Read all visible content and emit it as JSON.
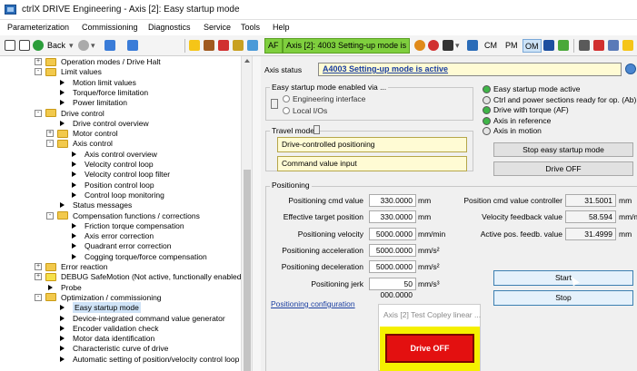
{
  "window": {
    "title": "ctrlX DRIVE Engineering - Axis [2]: Easy startup mode"
  },
  "menu": [
    "Parameterization",
    "Commissioning",
    "Diagnostics",
    "Service",
    "Tools",
    "Help"
  ],
  "toolbar": {
    "back_label": "Back",
    "af_label": "AF",
    "axis_status_text": "Axis [2]:  4003 Setting-up mode is a",
    "cm": "CM",
    "pm": "PM",
    "om": "OM"
  },
  "tree": [
    {
      "label": "Operation modes / Drive Halt",
      "depth": 1,
      "kind": "folder",
      "exp": "+"
    },
    {
      "label": "Limit values",
      "depth": 1,
      "kind": "folder",
      "exp": "-"
    },
    {
      "label": "Motion limit values",
      "depth": 2,
      "kind": "leaf"
    },
    {
      "label": "Torque/force limitation",
      "depth": 2,
      "kind": "leaf"
    },
    {
      "label": "Power limitation",
      "depth": 2,
      "kind": "leaf"
    },
    {
      "label": "Drive control",
      "depth": 1,
      "kind": "folder",
      "exp": "-"
    },
    {
      "label": "Drive control overview",
      "depth": 2,
      "kind": "leaf"
    },
    {
      "label": "Motor control",
      "depth": 2,
      "kind": "folder",
      "exp": "+"
    },
    {
      "label": "Axis control",
      "depth": 2,
      "kind": "folder",
      "exp": "-"
    },
    {
      "label": "Axis control overview",
      "depth": 3,
      "kind": "leaf"
    },
    {
      "label": "Velocity control loop",
      "depth": 3,
      "kind": "leaf"
    },
    {
      "label": "Velocity control loop filter",
      "depth": 3,
      "kind": "leaf"
    },
    {
      "label": "Position control loop",
      "depth": 3,
      "kind": "leaf"
    },
    {
      "label": "Control loop monitoring",
      "depth": 3,
      "kind": "leaf"
    },
    {
      "label": "Status messages",
      "depth": 2,
      "kind": "leaf"
    },
    {
      "label": "Compensation functions / corrections",
      "depth": 2,
      "kind": "folder",
      "exp": "-"
    },
    {
      "label": "Friction torque compensation",
      "depth": 3,
      "kind": "leaf"
    },
    {
      "label": "Axis error correction",
      "depth": 3,
      "kind": "leaf"
    },
    {
      "label": "Quadrant error correction",
      "depth": 3,
      "kind": "leaf"
    },
    {
      "label": "Cogging torque/force compensation",
      "depth": 3,
      "kind": "leaf"
    },
    {
      "label": "Error reaction",
      "depth": 1,
      "kind": "folder",
      "exp": "+"
    },
    {
      "label": "DEBUG SafeMotion (Not active, functionally enabled): def",
      "depth": 1,
      "kind": "safe",
      "exp": "+"
    },
    {
      "label": "Probe",
      "depth": 1,
      "kind": "leaf"
    },
    {
      "label": "Optimization / commissioning",
      "depth": 1,
      "kind": "folder",
      "exp": "-"
    },
    {
      "label": "Easy startup mode",
      "depth": 2,
      "kind": "leaf",
      "selected": true
    },
    {
      "label": "Device-integrated command value generator",
      "depth": 2,
      "kind": "leaf"
    },
    {
      "label": "Encoder validation check",
      "depth": 2,
      "kind": "leaf"
    },
    {
      "label": "Motor data identification",
      "depth": 2,
      "kind": "leaf"
    },
    {
      "label": "Characteristic curve of drive",
      "depth": 2,
      "kind": "leaf"
    },
    {
      "label": "Automatic setting of position/velocity control loop",
      "depth": 2,
      "kind": "leaf"
    }
  ],
  "main": {
    "axis_status_label": "Axis status",
    "axis_status_value": "A4003 Setting-up mode is active",
    "easy_group_title": "Easy startup mode enabled via ...",
    "radio_engineering": "Engineering interface",
    "radio_local": "Local I/Os",
    "travel_mode_title": "Travel mode",
    "travel_mode_value": "Drive-controlled positioning",
    "travel_input_value": "Command value input",
    "status_leds": [
      {
        "label": "Easy startup mode active",
        "color": "#3fb548"
      },
      {
        "label": "Ctrl and power sections ready for op. (Ab)",
        "color": "#e4e4e4"
      },
      {
        "label": "Drive with torque (AF)",
        "color": "#3fb548"
      },
      {
        "label": "Axis in reference",
        "color": "#3fb548"
      },
      {
        "label": "Axis in motion",
        "color": "#e4e4e4"
      }
    ],
    "stop_easy_btn": "Stop easy startup mode",
    "drive_off_btn": "Drive OFF",
    "positioning_title": "Positioning",
    "pos_rows": [
      {
        "label": "Positioning cmd value",
        "value": "330.0000",
        "unit": "mm"
      },
      {
        "label": "Effective target position",
        "value": "330.0000",
        "unit": "mm"
      },
      {
        "label": "Positioning velocity",
        "value": "5000.0000",
        "unit": "mm/min"
      },
      {
        "label": "Positioning acceleration",
        "value": "5000.0000",
        "unit": "mm/s²"
      },
      {
        "label": "Positioning deceleration",
        "value": "5000.0000",
        "unit": "mm/s²"
      },
      {
        "label": "Positioning jerk",
        "value": "50 000.0000",
        "unit": "mm/s³"
      }
    ],
    "ctrl_rows": [
      {
        "label": "Position cmd value controller",
        "value": "31.5001",
        "unit": "mm"
      },
      {
        "label": "Velocity feedback value",
        "value": "58.594",
        "unit": "mm/m"
      },
      {
        "label": "Active pos. feedb. value",
        "value": "31.4999",
        "unit": "mm"
      }
    ],
    "start_btn": "Start",
    "stop_btn": "Stop",
    "pos_config_link": "Positioning configuration"
  },
  "popup": {
    "title": "Axis [2] Test Copley linear ...",
    "drive_off": "Drive OFF"
  }
}
